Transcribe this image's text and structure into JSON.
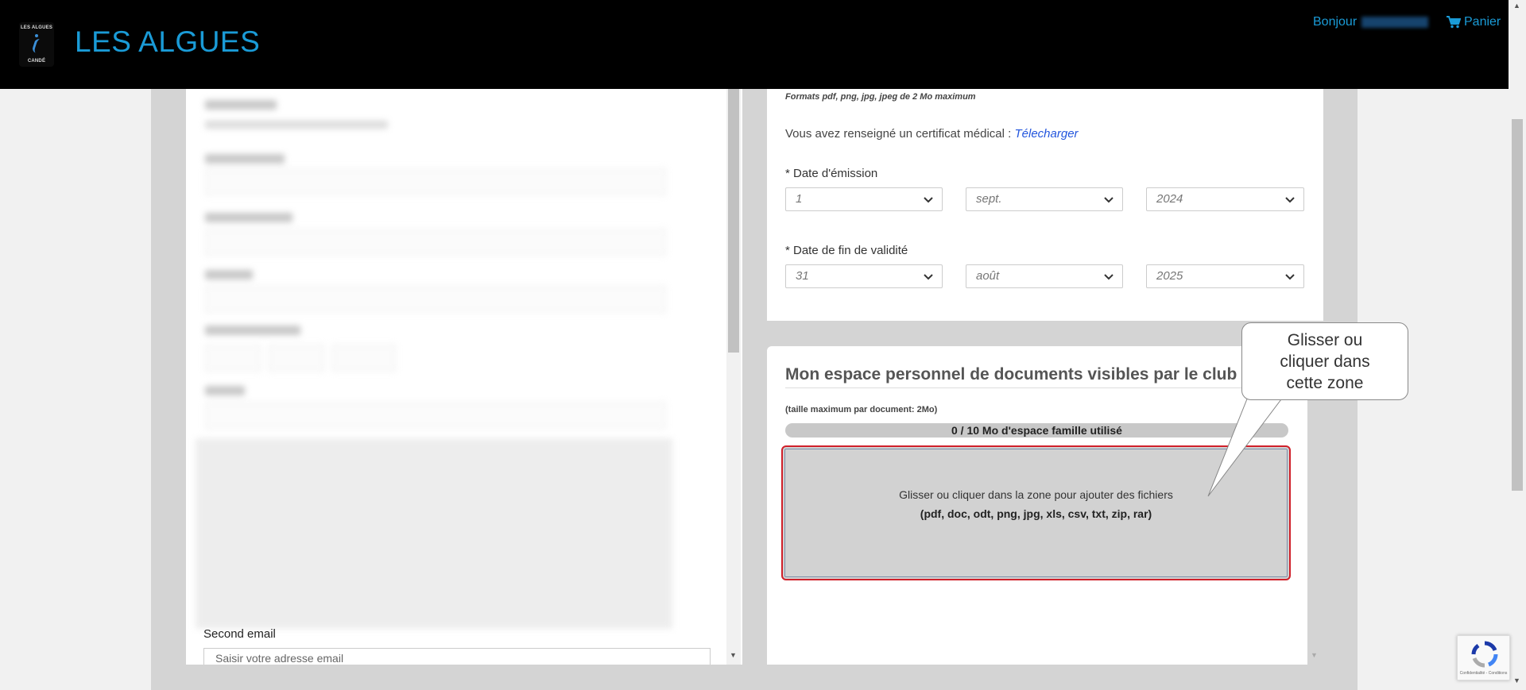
{
  "header": {
    "logo_text_top": "LES ALGUES",
    "logo_text_bottom": "CANDÉ",
    "site_title": "LES ALGUES",
    "greeting": "Bonjour",
    "cart_label": "Panier"
  },
  "left_form": {
    "second_email_label": "Second email",
    "second_email_placeholder": "Saisir votre adresse email"
  },
  "medical": {
    "formats_note": "Formats pdf, png, jpg, jpeg de 2 Mo maximum",
    "certificate_text": "Vous avez renseigné un certificat médical :",
    "download_link": "Télecharger",
    "issue_date_label": "* Date d'émission",
    "issue_day": "1",
    "issue_month": "sept.",
    "issue_year": "2024",
    "end_date_label": "* Date de fin de validité",
    "end_day": "31",
    "end_month": "août",
    "end_year": "2025"
  },
  "documents": {
    "title": "Mon espace personnel de documents visibles par le club",
    "max_size": "(taille maximum par document: 2Mo)",
    "usage_text": "0 / 10 Mo d'espace famille utilisé",
    "usage_fraction": 0,
    "dropzone_text": "Glisser ou cliquer dans la zone pour ajouter des fichiers",
    "dropzone_types": "(pdf, doc, odt, png, jpg, xls, csv, txt, zip, rar)"
  },
  "callout": {
    "line1": "Glisser ou",
    "line2": "cliquer dans",
    "line3": "cette zone"
  },
  "recaptcha": {
    "footer": "Confidentialité - Conditions"
  },
  "colors": {
    "accent": "#1a9bd7",
    "link": "#2255dd",
    "dropzone_border": "#d0202a"
  }
}
